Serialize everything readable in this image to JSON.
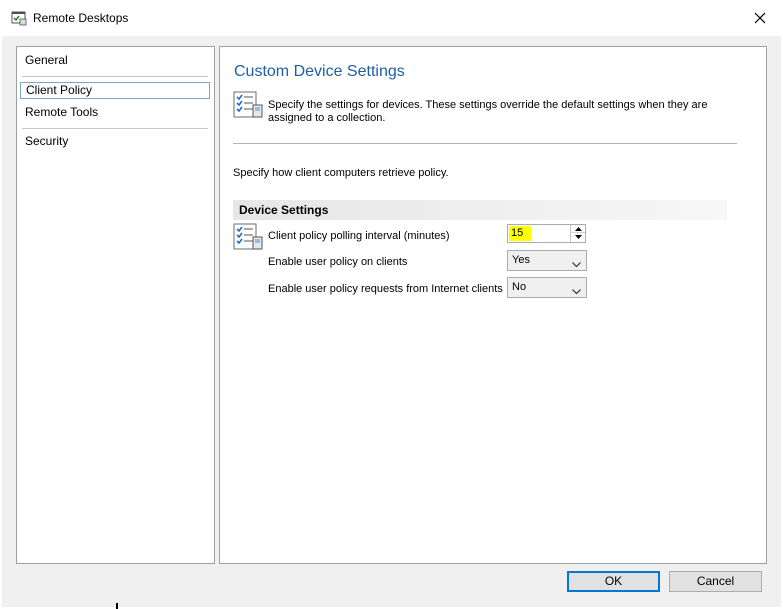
{
  "window": {
    "title": "Remote Desktops",
    "app_icon": "window-settings-icon",
    "close_icon": "close-icon"
  },
  "nav": {
    "items": [
      {
        "label": "General",
        "selected": false
      },
      {
        "label": "Client Policy",
        "selected": true
      },
      {
        "label": "Remote Tools",
        "selected": false
      },
      {
        "label": "Security",
        "selected": false
      }
    ]
  },
  "content": {
    "title": "Custom Device Settings",
    "header_icon": "checklist-settings-icon",
    "header_description": "Specify the settings for devices. These settings override the default settings when they are assigned to a collection.",
    "intro": "Specify how client computers retrieve policy.",
    "group_title": "Device Settings",
    "settings": {
      "polling_interval": {
        "label": "Client policy polling interval (minutes)",
        "value": "15",
        "icon": "checklist-settings-icon"
      },
      "user_policy": {
        "label": "Enable user policy on clients",
        "value": "Yes"
      },
      "internet_user_policy": {
        "label": "Enable user policy requests from Internet clients",
        "value": "No"
      }
    }
  },
  "buttons": {
    "ok": "OK",
    "cancel": "Cancel"
  },
  "colors": {
    "title_accent": "#1e5fa8",
    "highlight": "#ffff00",
    "selection_border": "#7da2ce",
    "default_button_border": "#0078d7"
  }
}
